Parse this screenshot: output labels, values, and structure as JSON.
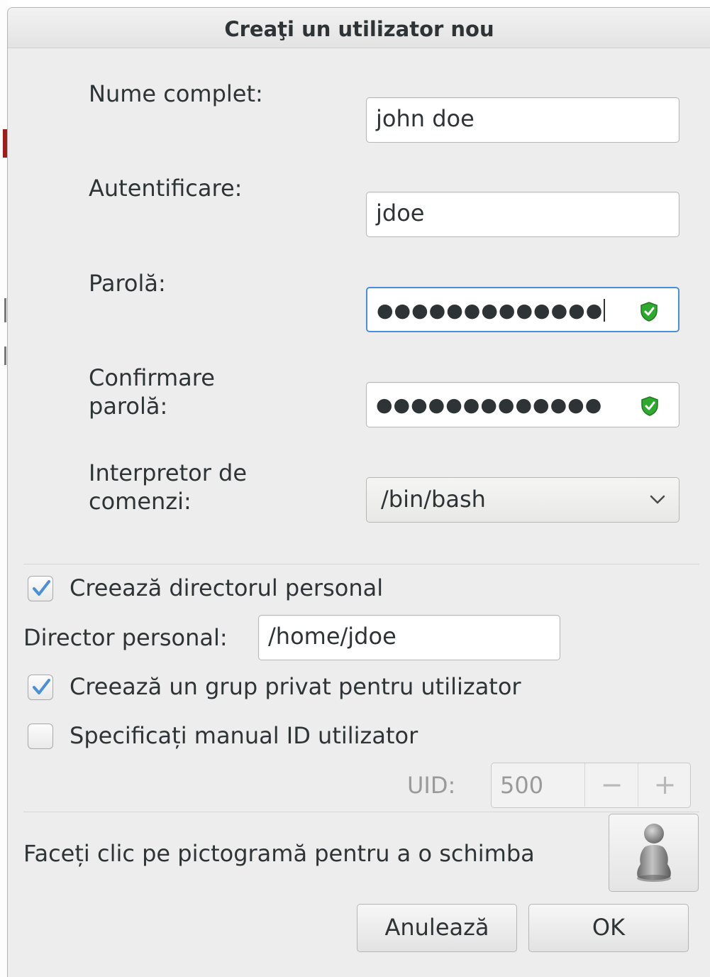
{
  "dialog": {
    "title": "Creaţi un utilizator nou"
  },
  "form": {
    "full_name": {
      "label": "Nume complet:",
      "value": "john doe"
    },
    "login": {
      "label": "Autentificare:",
      "value": "jdoe"
    },
    "password": {
      "label": "Parolă:",
      "value": "●●●●●●●●●●●●●",
      "strength_icon": "shield-ok-icon"
    },
    "confirm_password": {
      "label_line1": "Confirmare",
      "label_line2": "parolă:",
      "value": "●●●●●●●●●●●●●",
      "strength_icon": "shield-ok-icon"
    },
    "shell": {
      "label_line1": "Interpretor de",
      "label_line2": "comenzi:",
      "value": "/bin/bash"
    }
  },
  "home": {
    "create_home_label": "Creează directorul personal",
    "create_home_checked": true,
    "home_dir_label": "Director personal:",
    "home_dir_value": "/home/jdoe"
  },
  "group": {
    "private_group_label": "Creează un grup privat pentru utilizator",
    "private_group_checked": true
  },
  "uid": {
    "manual_label": "Specificați manual ID utilizator",
    "manual_checked": false,
    "uid_label": "UID:",
    "uid_value": "500",
    "minus": "−",
    "plus": "+"
  },
  "icon_section": {
    "hint": "Faceți clic pe pictogramă pentru a o schimba",
    "avatar_icon": "user-avatar-icon"
  },
  "buttons": {
    "cancel": "Anulează",
    "ok": "OK"
  },
  "colors": {
    "focus": "#4a90d9",
    "check": "#4a90d9",
    "shield": "#2fa82f"
  }
}
